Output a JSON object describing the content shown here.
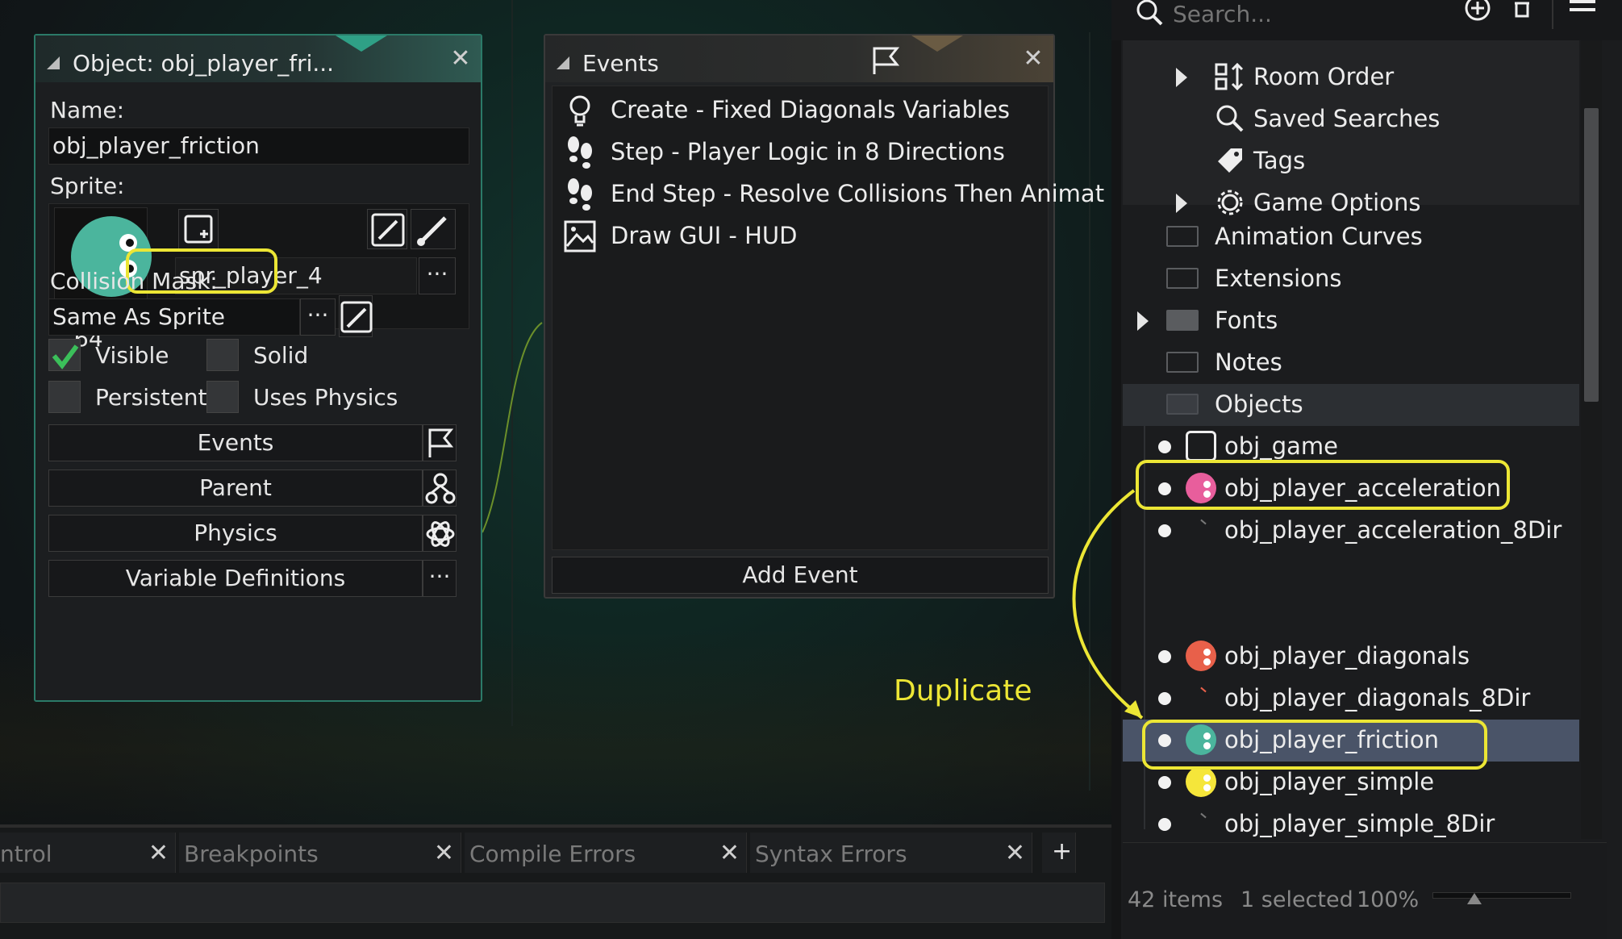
{
  "object_panel": {
    "title": "Object: obj_player_fri...",
    "name_label": "Name:",
    "name_value": "obj_player_friction",
    "sprite_label": "Sprite:",
    "sprite_name": "spr_player_4",
    "sprite_size": "64 x 64",
    "collision_label": "Collision Mask:",
    "collision_value": "Same As Sprite",
    "checkboxes": [
      {
        "label": "Visible",
        "checked": true
      },
      {
        "label": "Solid",
        "checked": false
      },
      {
        "label": "Persistent",
        "checked": false
      },
      {
        "label": "Uses Physics",
        "checked": false
      }
    ],
    "buttons": {
      "events": "Events",
      "parent": "Parent",
      "physics": "Physics",
      "variable_definitions": "Variable Definitions"
    },
    "ellipsis": "···",
    "sprite_color": "#4bb59d"
  },
  "events_panel": {
    "title": "Events",
    "events": [
      {
        "icon": "lightbulb-icon",
        "label": "Create - Fixed Diagonals Variables"
      },
      {
        "icon": "footsteps-icon",
        "label": "Step - Player Logic in 8 Directions"
      },
      {
        "icon": "footsteps-icon",
        "label": "End Step - Resolve Collisions Then Animat"
      },
      {
        "icon": "picture-icon",
        "label": "Draw GUI - HUD"
      }
    ],
    "add_event": "Add Event"
  },
  "annotation": {
    "text": "Duplicate",
    "color": "#ece635"
  },
  "bottom_tabs": [
    {
      "label": "ntrol"
    },
    {
      "label": "Breakpoints"
    },
    {
      "label": "Compile Errors"
    },
    {
      "label": "Syntax Errors"
    }
  ],
  "add_tab": "+",
  "resource_tree": {
    "search_placeholder": "Search...",
    "top_items": [
      {
        "icon": "room-order-icon",
        "label": "Room Order"
      },
      {
        "icon": "search-icon",
        "label": "Saved Searches"
      },
      {
        "icon": "tag-icon",
        "label": "Tags"
      },
      {
        "icon": "gear-icon",
        "label": "Game Options"
      }
    ],
    "folders": [
      {
        "label": "Animation Curves"
      },
      {
        "label": "Extensions"
      },
      {
        "label": "Fonts"
      },
      {
        "label": "Notes"
      },
      {
        "label": "Objects"
      }
    ],
    "objects": [
      {
        "label": "obj_game",
        "color": ""
      },
      {
        "label": "obj_player_acceleration",
        "color": "#e85e9c"
      },
      {
        "label": "obj_player_acceleration_8Dir",
        "color": ""
      },
      {
        "label": "obj_player_diagonals",
        "color": "#e8604a"
      },
      {
        "label": "obj_player_diagonals_8Dir",
        "color": ""
      },
      {
        "label": "obj_player_friction",
        "color": "#4bb59d"
      },
      {
        "label": "obj_player_simple",
        "color": "#f5e63a"
      },
      {
        "label": "obj_player_simple_8Dir",
        "color": ""
      }
    ],
    "status": {
      "items": "42 items",
      "selected": "1 selected",
      "zoom": "100%"
    },
    "selected_color": "#4a5468"
  }
}
